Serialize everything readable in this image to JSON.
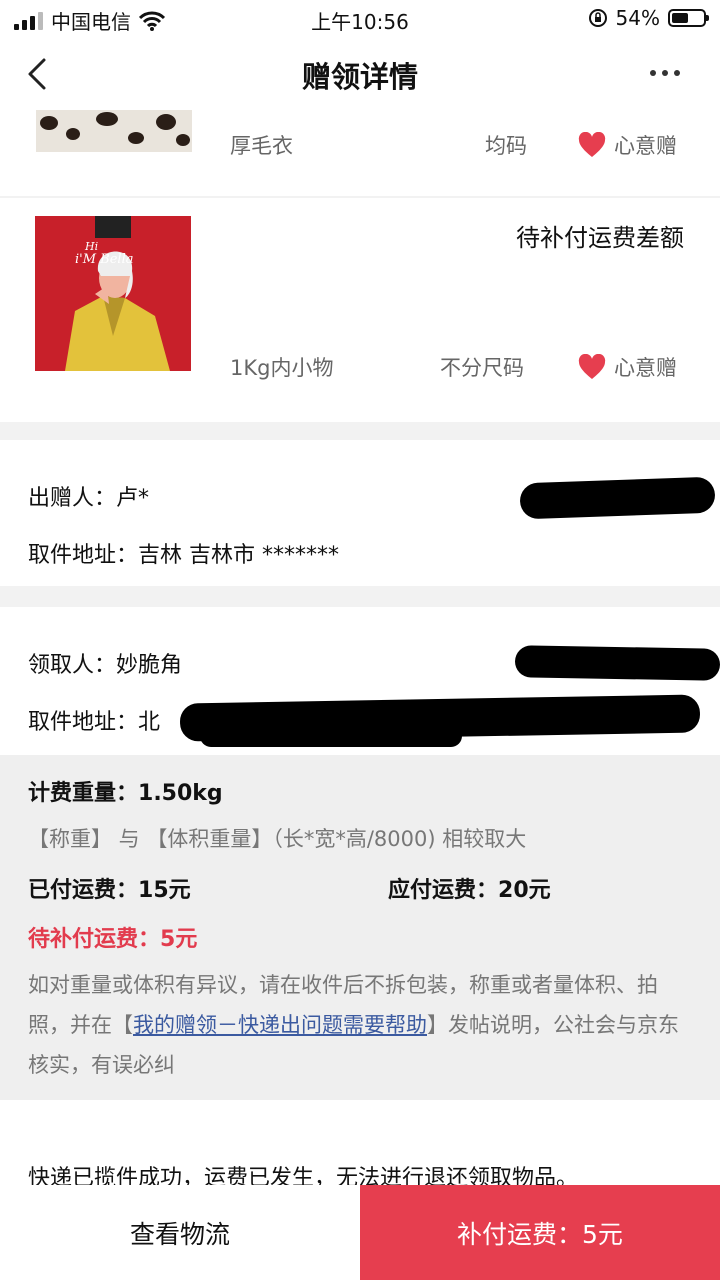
{
  "status_bar": {
    "carrier": "中国电信",
    "time": "上午10:56",
    "battery": "54%",
    "battery_level": 0.54
  },
  "nav": {
    "title": "赠领详情"
  },
  "items": [
    {
      "name": "厚毛衣",
      "size": "均码",
      "tag": "心意赠"
    },
    {
      "status": "待补付运费差额",
      "name": "1Kg内小物",
      "size": "不分尺码",
      "tag": "心意赠",
      "thumb_text": [
        "Hi",
        "i'M Bella"
      ]
    }
  ],
  "giver": {
    "label": "出赠人：",
    "name": "卢*",
    "address_label": "取件地址：",
    "address": "吉林 吉林市 *******"
  },
  "receiver": {
    "label": "领取人：",
    "name": "妙脆角",
    "address_label": "取件地址：",
    "address": "北"
  },
  "fee": {
    "weight_label": "计费重量：",
    "weight": "1.50kg",
    "rule": "【称重】 与 【体积重量】（长*宽*高/8000) 相较取大",
    "paid_label": "已付运费：",
    "paid": "15元",
    "due_label": "应付运费：",
    "due": "20元",
    "pending_label": "待补付运费：",
    "pending": "5元",
    "note_before": "如对重量或体积有异议，请在收件后不拆包装，称重或者量体积、拍照，并在【",
    "note_link": "我的赠领－快递出问题需要帮助",
    "note_after": "】发帖说明，公社会与京东核实，有误必纠"
  },
  "notice": "快递已揽件成功，运费已发生，无法进行退还领取物品。",
  "bottom": {
    "logistics": "查看物流",
    "pay": "补付运费：5元"
  },
  "colors": {
    "accent": "#e63e4f",
    "link": "#3b5aa0",
    "panel": "#efefef"
  }
}
